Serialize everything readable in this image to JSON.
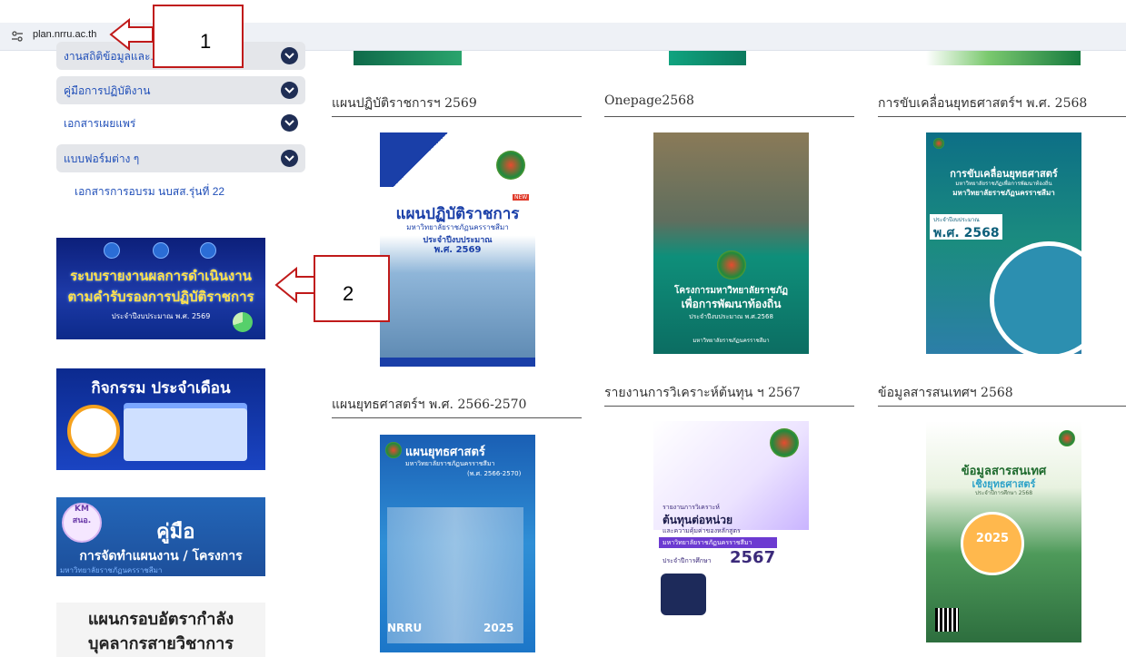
{
  "browser": {
    "url": "plan.nrru.ac.th"
  },
  "sidebar": {
    "items": [
      {
        "label": "งานสถิติข้อมูลและ..."
      },
      {
        "label": "คู่มือการปฏิบัติงาน"
      },
      {
        "label": "เอกสารเผยแพร่"
      },
      {
        "label": "แบบฟอร์มต่าง ๆ"
      }
    ],
    "plain_link": "เอกสารการอบรม นบสส.รุ่นที่ 22",
    "banners": {
      "report": {
        "line1": "ระบบรายงานผลการดำเนินงาน",
        "line2": "ตามคำรับรองการปฏิบัติราชการ",
        "line3": "ประจำปีงบประมาณ พ.ศ. 2569"
      },
      "activity": {
        "title": "กิจกรรม ประจำเดือน"
      },
      "manual": {
        "badge": "KM",
        "badge2": "สนอ.",
        "title": "คู่มือ",
        "subtitle": "การจัดทำแผนงาน / โครงการ",
        "org": "มหาวิทยาลัยราชภัฏนครราชสีมา"
      },
      "workforce": {
        "line1": "แผนกรอบอัตรากำลัง",
        "line2": "บุคลากรสายวิชาการ"
      }
    }
  },
  "annotations": {
    "label1": "1",
    "label2": "2"
  },
  "documents": [
    {
      "title": "แผนปฏิบัติราชการฯ 2569",
      "cover": {
        "heading": "แผนปฏิบัติราชการ",
        "org": "มหาวิทยาลัยราชภัฏนครราชสีมา",
        "sub": "ประจำปีงบประมาณ",
        "year": "พ.ศ. 2569",
        "tag": "NEW"
      }
    },
    {
      "title": "Onepage2568",
      "cover": {
        "heading": "โครงการมหาวิทยาลัยราชภัฏ",
        "heading2": "เพื่อการพัฒนาท้องถิ่น",
        "sub": "ประจำปีงบประมาณ พ.ศ.2568",
        "org": "มหาวิทยาลัยราชภัฏนครราชสีมา"
      }
    },
    {
      "title": "การขับเคลื่อนยุทธศาสตร์ฯ พ.ศ. 2568",
      "cover": {
        "heading": "การขับเคลื่อนยุทธศาสตร์",
        "sub": "มหาวิทยาลัยราชภัฏเพื่อการพัฒนาท้องถิ่น",
        "org": "มหาวิทยาลัยราชภัฏนครราชสีมา",
        "year_label": "ประจำปีงบประมาณ",
        "year": "พ.ศ. 2568"
      }
    },
    {
      "title": "แผนยุทธศาสตร์ฯ พ.ศ. 2566-2570",
      "cover": {
        "heading": "แผนยุทธศาสตร์",
        "org": "มหาวิทยาลัยราชภัฏนครราชสีมา",
        "years": "(พ.ศ. 2566-2570)",
        "mark": "NRRU",
        "year": "2025"
      }
    },
    {
      "title": "รายงานการวิเคราะห์ต้นทุน ฯ 2567",
      "cover": {
        "line1": "รายงานการวิเคราะห์",
        "heading": "ต้นทุนต่อหน่วย",
        "line3": "และความคุ้มค่าของหลักสูตร",
        "org": "มหาวิทยาลัยราชภัฏนครราชสีมา",
        "year_label": "ประจำปีการศึกษา",
        "year": "2567"
      }
    },
    {
      "title": "ข้อมูลสารสนเทศฯ 2568",
      "cover": {
        "heading": "ข้อมูลสารสนเทศ",
        "heading2": "เชิงยุทธศาสตร์",
        "sub": "ประจำปีการศึกษา 2568",
        "year": "2025"
      }
    }
  ]
}
